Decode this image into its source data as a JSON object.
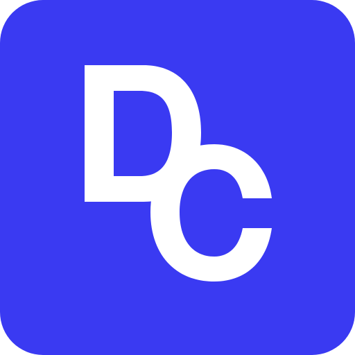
{
  "icon": {
    "name": "DC app icon",
    "letters": [
      "D",
      "C"
    ],
    "background_color": "#3a3af2",
    "glyph_color": "#ffffff",
    "shape": "rounded-square"
  }
}
